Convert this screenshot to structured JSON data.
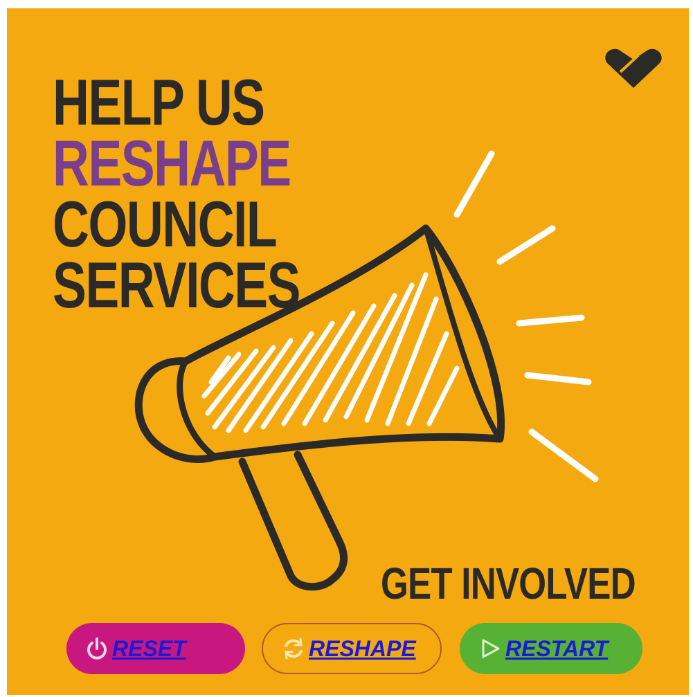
{
  "poster": {
    "headline": [
      "HELP US",
      "RESHAPE",
      "COUNCIL",
      "SERVICES"
    ],
    "cta": "GET INVOLVED",
    "colors": {
      "background": "#f4a911",
      "text": "#2b2a27",
      "accent": "#7a3f8c",
      "link": "#1a1adb"
    },
    "icons": [
      "heart-logo-icon",
      "megaphone-icon"
    ]
  },
  "buttons": [
    {
      "label": "RESET",
      "icon": "power-icon",
      "color": "#c8177e"
    },
    {
      "label": "RESHAPE",
      "icon": "refresh-icon",
      "color": "#b8571e"
    },
    {
      "label": "RESTART",
      "icon": "play-icon",
      "color": "#56b135"
    }
  ]
}
